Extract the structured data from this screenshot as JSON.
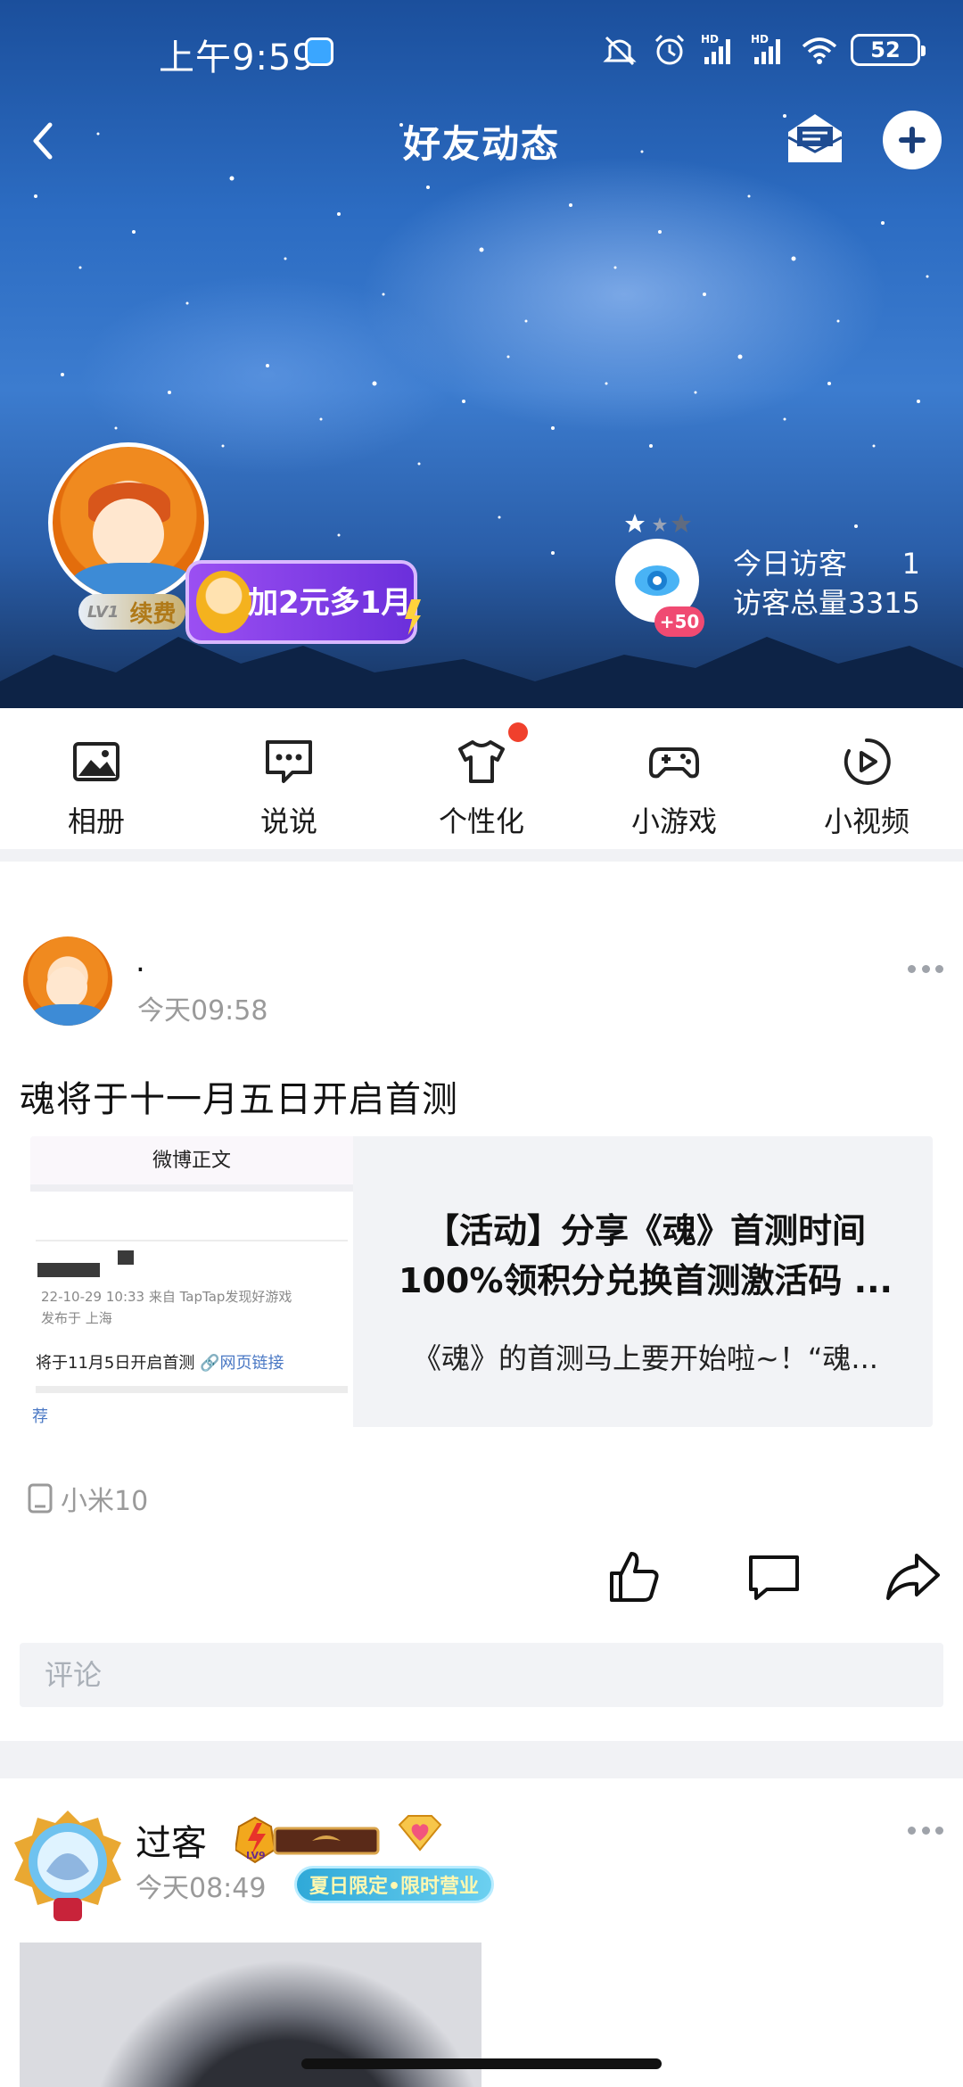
{
  "status_bar": {
    "time": "上午9:59",
    "signal_label_1": "HD",
    "signal_label_2": "HD",
    "battery": "52",
    "icons": [
      "mute-vibrate-icon",
      "alarm-icon",
      "signal-icon",
      "signal-icon",
      "wifi-icon",
      "battery-icon"
    ]
  },
  "nav": {
    "title": "好友动态",
    "icons": [
      "back-icon",
      "mail-icon",
      "add-icon"
    ]
  },
  "profile": {
    "level_badge": "LV1",
    "renew_label": "续费",
    "promo_text": "加2元多1月",
    "visitor_bonus": "+50",
    "today_visitors_label": "今日访客",
    "today_visitors_value": "1",
    "total_visitors_label": "访客总量",
    "total_visitors_value": "3315"
  },
  "shortcuts": [
    {
      "label": "相册",
      "icon": "photo-album-icon"
    },
    {
      "label": "说说",
      "icon": "chat-bubble-icon"
    },
    {
      "label": "个性化",
      "icon": "tshirt-icon",
      "has_red_dot": true
    },
    {
      "label": "小游戏",
      "icon": "gamepad-icon"
    },
    {
      "label": "小视频",
      "icon": "play-circle-icon"
    }
  ],
  "post1": {
    "author": ".",
    "time": "今天09:58",
    "text": "魂将于十一月五日开启首测",
    "link_card": {
      "thumb_header": "微博正文",
      "thumb_meta_line1": "22-10-29 10:33  来自 TapTap发现好游戏",
      "thumb_meta_line2": "发布于 上海",
      "thumb_text": "将于11月5日开启首测",
      "thumb_link": "🔗网页链接",
      "thumb_rec": "荐",
      "title_line1": "【活动】分享《魂》首测时间",
      "title_line2": "100%领积分兑换首测激活码 ...",
      "description": "《魂》的首测马上要开始啦~！“魂..."
    },
    "device": "小米10",
    "actions": [
      "like-icon",
      "comment-icon",
      "share-icon"
    ],
    "comment_placeholder": "评论"
  },
  "post2": {
    "author": "过客",
    "time": "今天08:49",
    "level_badge": "LV9",
    "summer_badge": "夏日限定•限时营业"
  },
  "colors": {
    "accent_red": "#f0402c",
    "visitor_pink": "#f04a72",
    "promo_purple": "#8a43ea",
    "link_blue": "#4a78c4"
  }
}
